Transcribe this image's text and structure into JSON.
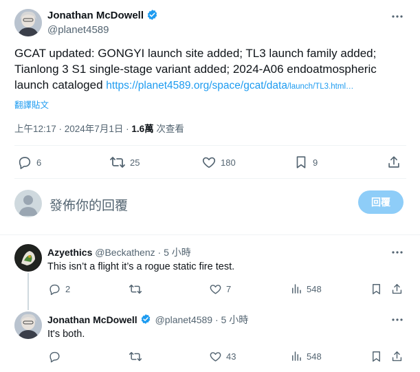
{
  "main_tweet": {
    "author_name": "Jonathan McDowell",
    "author_handle": "@planet4589",
    "text_line1": "GCAT updated:   GONGYI launch site added; TL3 launch family added;",
    "text_line2": "Tianlong 3 S1  single-stage variant added; 2024-A06  endoatmospheric",
    "text_line3_prefix": "launch cataloged ",
    "link_main": "https://planet4589.org/space/gcat/data",
    "link_tail": "/launch/TL3.html…",
    "translate_label": "翻譯貼文",
    "timestamp": "上午12:17 · 2024年7月1日 · ",
    "views_count": "1.6萬",
    "views_label": " 次查看",
    "stats": {
      "replies": "6",
      "retweets": "25",
      "likes": "180",
      "bookmarks": "9"
    }
  },
  "composer": {
    "placeholder": "發佈你的回覆",
    "reply_button": "回覆"
  },
  "replies": [
    {
      "author_name": "Azyethics",
      "author_handle": "@Beckathenz",
      "time": " · 5 小時",
      "text": "This isn’t a flight it’s a rogue static fire test.",
      "replies": "2",
      "retweets": "",
      "likes": "7",
      "views": "548"
    },
    {
      "author_name": "Jonathan McDowell",
      "author_handle": "@planet4589",
      "time": " · 5 小時",
      "text": "It's both.",
      "replies": "",
      "retweets": "",
      "likes": "43",
      "views": "548"
    }
  ],
  "colors": {
    "accent": "#1d9bf0",
    "text": "#0f1419",
    "muted": "#536471",
    "divider": "#eff3f4",
    "reply_button": "#8ecdf8"
  }
}
